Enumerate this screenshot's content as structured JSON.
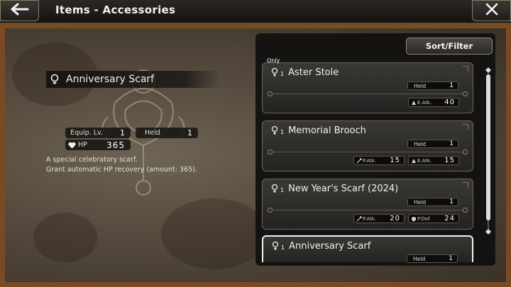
{
  "header": {
    "back_icon": "back-arrow-icon",
    "title": "Items - Accessories",
    "close_icon": "close-icon"
  },
  "detail": {
    "name": "Anniversary Scarf",
    "equip_label": "Equip. Lv.",
    "equip_value": "1",
    "held_label": "Held",
    "held_value": "1",
    "hp_label": "HP",
    "hp_value": "365",
    "desc_line1": "A special celebratory scarf.",
    "desc_line2": "Grant automatic HP recovery (amount: 365)."
  },
  "list": {
    "sort_label": "Sort/Filter",
    "items": [
      {
        "tag": "Only",
        "qty": "1",
        "name": "Aster Stole",
        "held_label": "Held",
        "held_value": "1",
        "stats": [
          {
            "label": "E.Atk.",
            "value": "40"
          }
        ]
      },
      {
        "qty": "1",
        "name": "Memorial Brooch",
        "held_label": "Held",
        "held_value": "1",
        "stats": [
          {
            "label": "P.Atk.",
            "value": "15"
          },
          {
            "label": "E.Atk.",
            "value": "15"
          }
        ]
      },
      {
        "qty": "1",
        "name": "New Year's Scarf (2024)",
        "held_label": "Held",
        "held_value": "1",
        "stats": [
          {
            "label": "P.Atk.",
            "value": "20"
          },
          {
            "label": "P.Def.",
            "value": "24"
          }
        ]
      },
      {
        "qty": "1",
        "name": "Anniversary Scarf",
        "held_label": "Held",
        "held_value": "1"
      }
    ]
  },
  "colors": {
    "frame": "#7a4b22",
    "panel": "#121110",
    "selected_border": "#f2f2f2"
  }
}
